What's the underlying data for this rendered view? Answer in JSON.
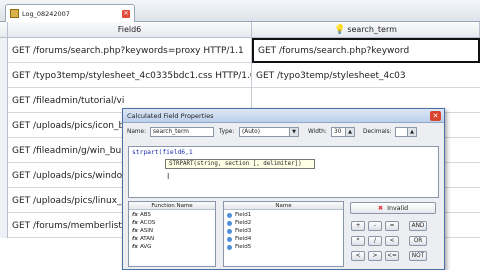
{
  "window": {
    "tab_title": "Log_08242007"
  },
  "grid": {
    "columns": [
      "Field6",
      "search_term"
    ],
    "rows": [
      {
        "field6": "GET /forums/search.php?keywords=proxy HTTP/1.1",
        "search_term": "GET /forums/search.php?keyword"
      },
      {
        "field6": "GET /typo3temp/stylesheet_4c0335bdc1.css HTTP/1.0",
        "search_term": "GET /typo3temp/stylesheet_4c03"
      },
      {
        "field6": "GET /fileadmin/tutorial/vi",
        "search_term": ""
      },
      {
        "field6": "GET /uploads/pics/icon_b",
        "search_term": ""
      },
      {
        "field6": "GET /fileadmin/g/win_bu",
        "search_term": ""
      },
      {
        "field6": "GET /uploads/pics/windo",
        "search_term": ""
      },
      {
        "field6": "GET /uploads/pics/linux_",
        "search_term": ""
      },
      {
        "field6": "GET /forums/memberlist",
        "search_term": ""
      }
    ]
  },
  "dialog": {
    "title": "Calculated Field Properties",
    "name_label": "Name:",
    "name_value": "search_term",
    "type_label": "Type:",
    "type_value": "(Auto)",
    "width_label": "Width:",
    "width_value": "30",
    "decimals_label": "Decimals:",
    "decimals_value": "",
    "expression": "strpart(field6,1",
    "tooltip": "STRPART(string, section [, delimiter])",
    "function_header": "Function Name",
    "functions": [
      "ABS",
      "ACOS",
      "ASIN",
      "ATAN",
      "AVG"
    ],
    "fields_header": "Name",
    "fields": [
      "Field1",
      "Field2",
      "Field3",
      "Field4",
      "Field5"
    ],
    "invalid_label": "Invalid",
    "operators": [
      [
        "+",
        "-",
        "=",
        "AND"
      ],
      [
        "*",
        "/",
        "<",
        "OR"
      ],
      [
        "<",
        ">",
        "<=",
        "NOT"
      ]
    ]
  }
}
